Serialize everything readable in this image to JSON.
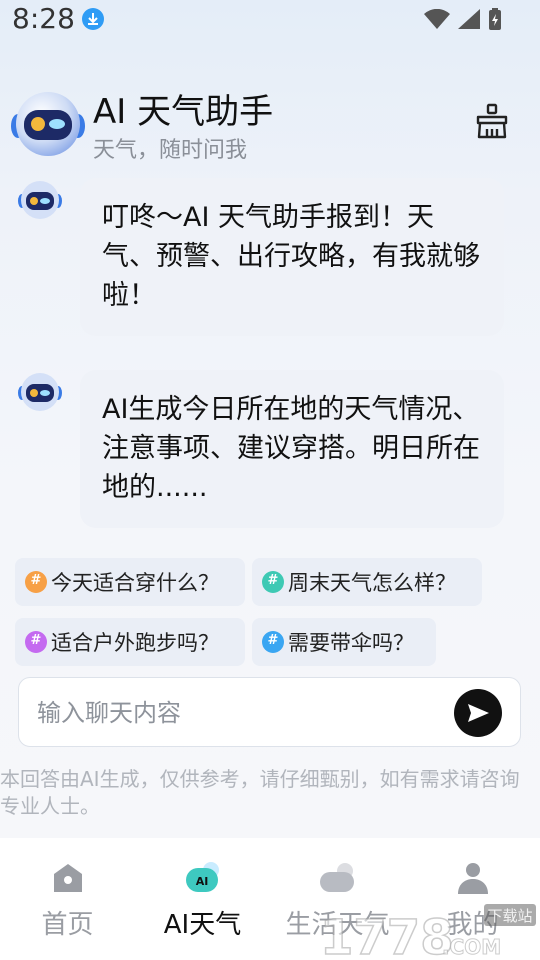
{
  "status_bar": {
    "time": "8:28"
  },
  "header": {
    "title": "AI 天气助手",
    "subtitle": "天气，随时问我"
  },
  "messages": [
    {
      "text": "叮咚～AI 天气助手报到！天气、预警、出行攻略，有我就够啦！"
    },
    {
      "text": "AI生成今日所在地的天气情况、注意事项、建议穿搭。明日所在地的......"
    }
  ],
  "suggestions": [
    {
      "label": "今天适合穿什么？",
      "color": "#f7a046"
    },
    {
      "label": "周末天气怎么样？",
      "color": "#3ec9b4"
    },
    {
      "label": "适合户外跑步吗？",
      "color": "#c46af0"
    },
    {
      "label": "需要带伞吗？",
      "color": "#3aa6f2"
    }
  ],
  "input": {
    "placeholder": "输入聊天内容"
  },
  "disclaimer": "本回答由AI生成，仅供参考，请仔细甄别，如有需求请咨询专业人士。",
  "tabs": [
    {
      "label": "首页",
      "icon": "home-icon"
    },
    {
      "label": "AI天气",
      "icon": "ai-icon"
    },
    {
      "label": "生活天气",
      "icon": "cloud-icon"
    },
    {
      "label": "我的",
      "icon": "user-icon"
    }
  ],
  "watermark": {
    "text": "1778.COM",
    "badge": "下载站"
  }
}
